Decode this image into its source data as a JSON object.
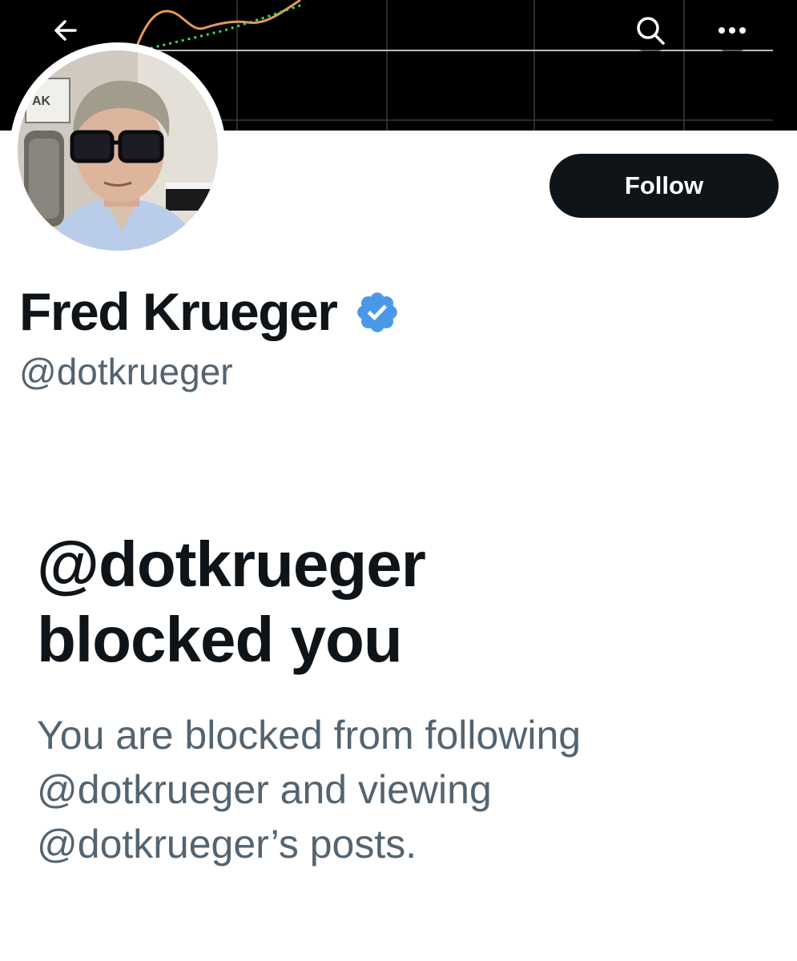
{
  "header": {
    "back_icon": "arrow-left-icon",
    "search_icon": "search-icon",
    "more_icon": "more-horizontal-icon"
  },
  "profile": {
    "display_name": "Fred Krueger",
    "handle": "@dotkrueger",
    "verified": true,
    "verified_color": "#4a99e9",
    "follow_label": "Follow"
  },
  "blocked": {
    "title_line1": "@dotkrueger",
    "title_line2": "blocked you",
    "desc_line1": "You are blocked from following",
    "desc_line2": "@dotkrueger and viewing",
    "desc_line3": "@dotkrueger’s posts."
  },
  "colors": {
    "text_primary": "#0f1419",
    "text_secondary": "#536471",
    "button_bg": "#0f1419",
    "banner_bg": "#000000"
  }
}
